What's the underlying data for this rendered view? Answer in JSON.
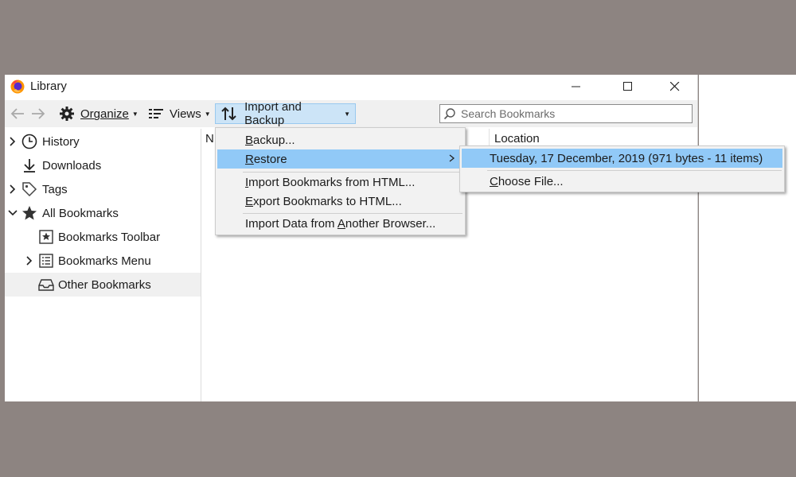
{
  "window": {
    "title": "Library",
    "controls": {
      "minimize": "minimize",
      "maximize": "maximize",
      "close": "close"
    }
  },
  "toolbar": {
    "organize_label": "Organize",
    "views_label": "Views",
    "import_backup_label": "Import and Backup",
    "search_placeholder": "Search Bookmarks"
  },
  "sidebar": {
    "items": [
      {
        "label": "History",
        "icon": "clock-icon",
        "expander": "collapsed"
      },
      {
        "label": "Downloads",
        "icon": "download-icon",
        "expander": "none"
      },
      {
        "label": "Tags",
        "icon": "tag-icon",
        "expander": "collapsed"
      },
      {
        "label": "All Bookmarks",
        "icon": "star-icon",
        "expander": "expanded"
      },
      {
        "label": "Bookmarks Toolbar",
        "icon": "bookmarks-toolbar-icon",
        "expander": "none"
      },
      {
        "label": "Bookmarks Menu",
        "icon": "bookmarks-menu-icon",
        "expander": "collapsed"
      },
      {
        "label": "Other Bookmarks",
        "icon": "tray-icon",
        "expander": "none",
        "selected": true
      }
    ]
  },
  "content": {
    "columns": {
      "name": "N",
      "location": "Location"
    }
  },
  "import_menu": {
    "backup_key": "B",
    "backup_rest": "ackup...",
    "restore_key": "R",
    "restore_rest": "estore",
    "import_html_key": "I",
    "import_html_rest": "mport Bookmarks from HTML...",
    "export_html_key": "E",
    "export_html_rest": "xport Bookmarks to HTML...",
    "import_browser_pre": "Import Data from ",
    "import_browser_key": "A",
    "import_browser_rest": "nother Browser..."
  },
  "restore_submenu": {
    "backup_entry": "Tuesday, 17 December, 2019 (971 bytes - 11 items)",
    "choose_file_key": "C",
    "choose_file_rest": "hoose File..."
  },
  "colors": {
    "desktop": "#8d8481",
    "toolbar_bg": "#f0f0f0",
    "menu_highlight": "#91c9f7",
    "active_button": "#cce4f7"
  }
}
